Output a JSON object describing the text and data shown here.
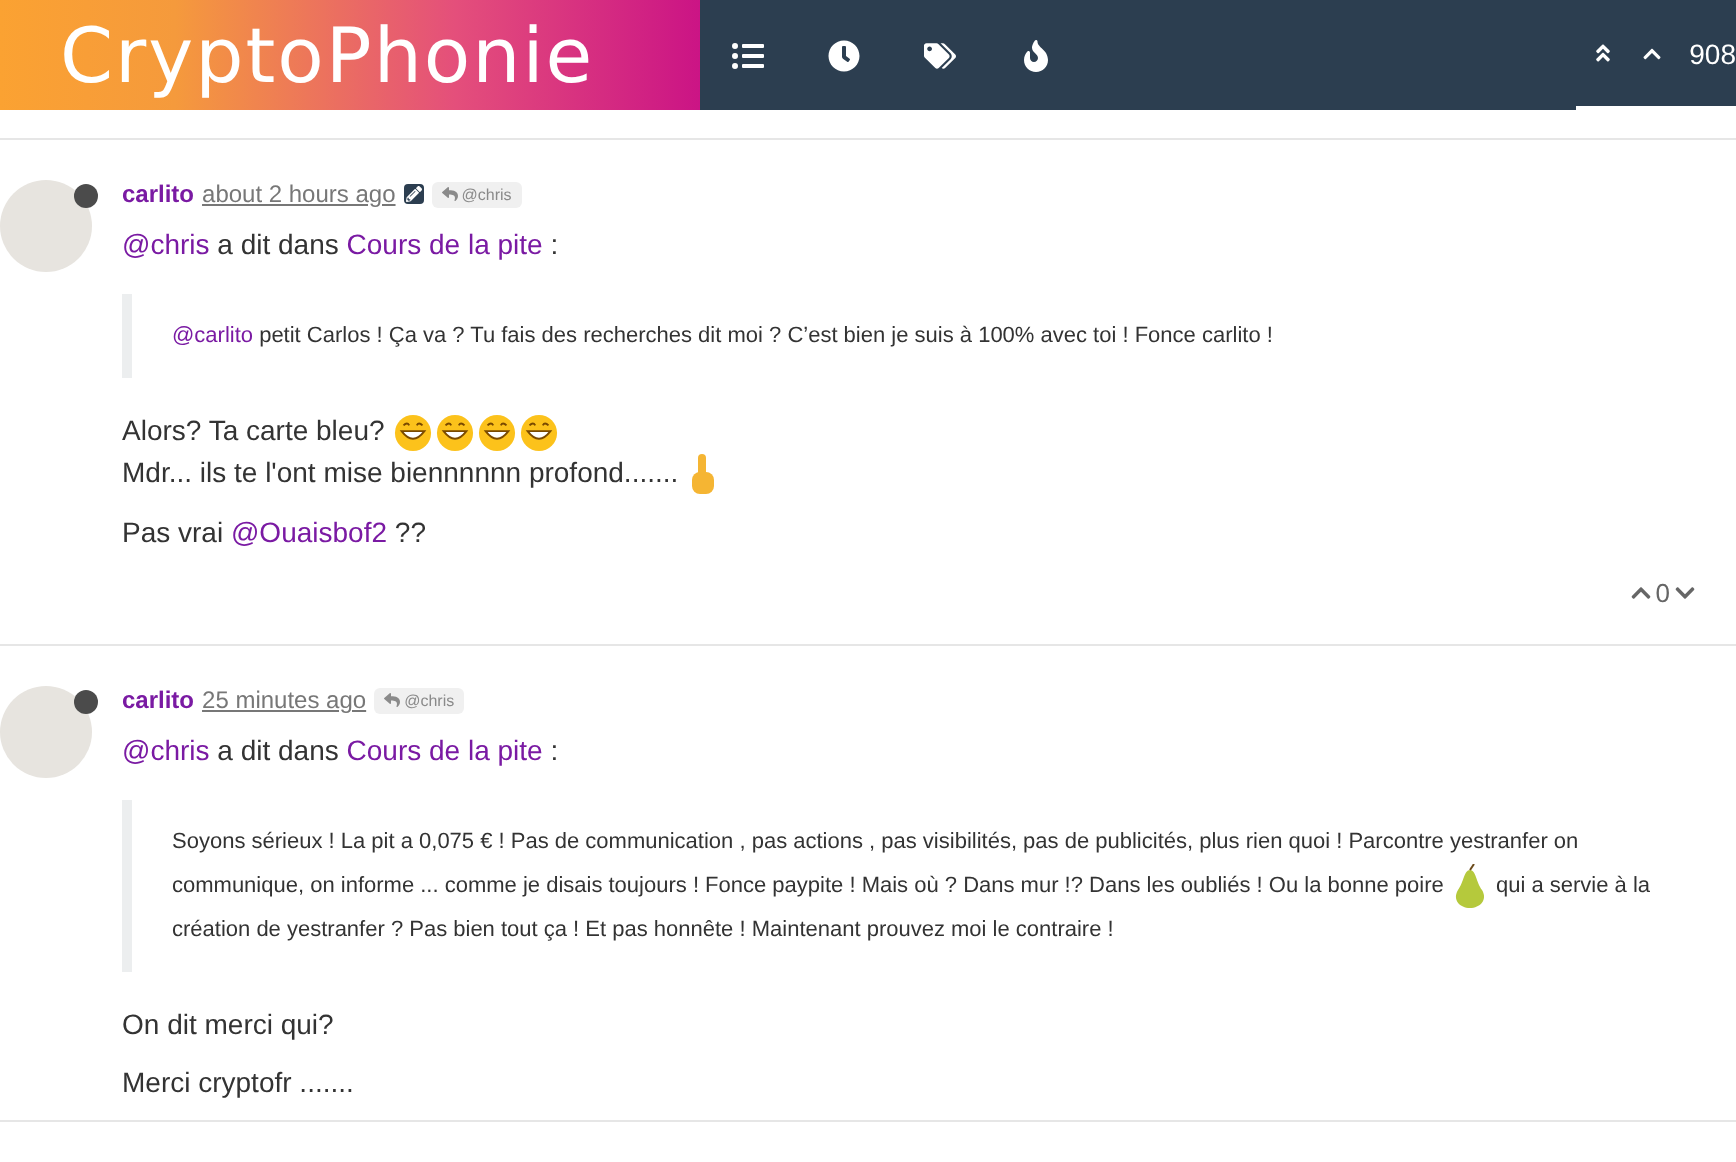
{
  "header": {
    "logo": "CryptoPhonie",
    "counter": "908"
  },
  "posts": [
    {
      "author": "carlito",
      "time": "about 2 hours ago",
      "edited": true,
      "reply_to": "@chris",
      "quote_head": [
        {
          "kind": "mention",
          "text": "@chris"
        },
        {
          "kind": "text",
          "text": " a dit dans "
        },
        {
          "kind": "link",
          "text": "Cours de la pite"
        },
        {
          "kind": "text",
          "text": " :"
        }
      ],
      "quote": [
        {
          "kind": "mention",
          "text": "@carlito"
        },
        {
          "kind": "text",
          "text": " petit Carlos ! Ça va ? Tu fais des recherches dit moi ? C’est bien je suis à 100% avec toi ! Fonce carlito !"
        }
      ],
      "paragraphs": [
        [
          {
            "kind": "text",
            "text": "Alors? Ta carte bleu? "
          },
          {
            "kind": "grin"
          },
          {
            "kind": "grin"
          },
          {
            "kind": "grin"
          },
          {
            "kind": "grin"
          },
          {
            "kind": "break"
          },
          {
            "kind": "text",
            "text": "Mdr... ils te l'ont mise biennnnnn profond....... "
          },
          {
            "kind": "finger"
          }
        ],
        [
          {
            "kind": "text",
            "text": "Pas vrai "
          },
          {
            "kind": "mention",
            "text": "@Ouaisbof2"
          },
          {
            "kind": "text",
            "text": " ??"
          }
        ]
      ],
      "votes": "0"
    },
    {
      "author": "carlito",
      "time": "25 minutes ago",
      "edited": false,
      "reply_to": "@chris",
      "quote_head": [
        {
          "kind": "mention",
          "text": "@chris"
        },
        {
          "kind": "text",
          "text": " a dit dans "
        },
        {
          "kind": "link",
          "text": "Cours de la pite"
        },
        {
          "kind": "text",
          "text": " :"
        }
      ],
      "quote": [
        {
          "kind": "text",
          "text": "Soyons sérieux ! La pit a 0,075 € ! Pas de communication , pas actions , pas visibilités, pas de publicités, plus rien quoi ! Parcontre yestranfer on communique, on informe ... comme je disais toujours ! Fonce paypite ! Mais où ? Dans mur !? Dans les oubliés ! Ou la bonne poire "
        },
        {
          "kind": "pear"
        },
        {
          "kind": "text",
          "text": " qui a servie à la création de yestranfer ? Pas bien tout ça ! Et pas honnête ! Maintenant prouvez moi le contraire !"
        }
      ],
      "paragraphs": [
        [
          {
            "kind": "text",
            "text": "On dit merci qui?"
          }
        ],
        [
          {
            "kind": "text",
            "text": "Merci cryptofr ......."
          }
        ]
      ]
    }
  ]
}
